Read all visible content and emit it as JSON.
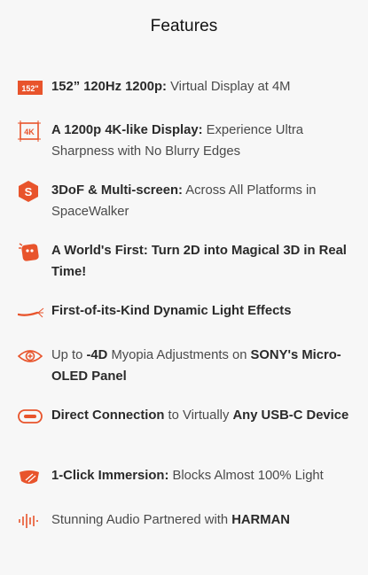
{
  "title": "Features",
  "accent_color": "#e8542c",
  "features": [
    {
      "icon": "152-inch-display-icon",
      "badge": "152\"",
      "parts": [
        {
          "t": "152” 120Hz 1200p:",
          "bold": true
        },
        {
          "t": " Virtual Display at 4M",
          "bold": false
        }
      ]
    },
    {
      "icon": "4k-display-icon",
      "badge": "4K",
      "parts": [
        {
          "t": "A 1200p 4K-like Display:",
          "bold": true
        },
        {
          "t": " Experience Ultra Sharpness with No Blurry Edges",
          "bold": false
        }
      ]
    },
    {
      "icon": "spacewalker-s-icon",
      "badge": "S",
      "parts": [
        {
          "t": "3DoF & Multi-screen:",
          "bold": true
        },
        {
          "t": " Across All Platforms in SpaceWalker",
          "bold": false
        }
      ]
    },
    {
      "icon": "2d-to-3d-icon",
      "parts": [
        {
          "t": "A World's First: Turn 2D into Magical 3D in Real Time!",
          "bold": true
        }
      ]
    },
    {
      "icon": "light-effects-icon",
      "parts": [
        {
          "t": "First-of-its-Kind Dynamic Light Effects",
          "bold": true
        }
      ]
    },
    {
      "icon": "eye-myopia-icon",
      "parts": [
        {
          "t": "Up to ",
          "bold": false
        },
        {
          "t": "-4D",
          "bold": true
        },
        {
          "t": " Myopia Adjustments on ",
          "bold": false
        },
        {
          "t": "SONY's Micro-OLED Panel",
          "bold": true
        }
      ]
    },
    {
      "icon": "usb-c-icon",
      "parts": [
        {
          "t": "Direct Connection",
          "bold": true
        },
        {
          "t": " to Virtually ",
          "bold": false
        },
        {
          "t": "Any USB-C Device",
          "bold": true
        }
      ]
    },
    {
      "icon": "immersion-shade-icon",
      "parts": [
        {
          "t": "1-Click Immersion:",
          "bold": true
        },
        {
          "t": " Blocks Almost 100% Light",
          "bold": false
        }
      ]
    },
    {
      "icon": "audio-waveform-icon",
      "parts": [
        {
          "t": "Stunning Audio Partnered with ",
          "bold": false
        },
        {
          "t": "HARMAN",
          "bold": true
        }
      ]
    }
  ]
}
